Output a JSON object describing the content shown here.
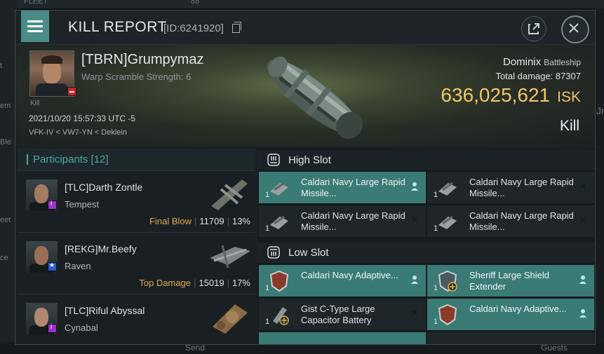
{
  "background": {
    "top_text": "FLEET",
    "top_count": "88",
    "left_fragments": [
      "t",
      "em",
      "Ble",
      "eet",
      "ce"
    ],
    "right_fragments": [
      "Jr"
    ],
    "bottom_send": "Send",
    "bottom_guests": "Guests"
  },
  "window": {
    "title": "KILL REPORT",
    "id_text": "[ID:6241920]",
    "icons": [
      "menu-icon",
      "copy-icon",
      "external-link-icon",
      "close-icon"
    ]
  },
  "victim": {
    "name": "[TBRN]Grumpymaz",
    "warp": "Warp Scramble Strength: 6",
    "kill_tag": "Kill",
    "time": "2021/10/20 15:57:33 UTC -5",
    "location": "VFK-IV < VW7-YN < Deklein"
  },
  "ship": {
    "name": "Dominix",
    "class": "Battleship",
    "total_damage_label": "Total damage:",
    "total_damage": "87307",
    "isk_value": "636,025,621",
    "isk_currency": "ISK",
    "result": "Kill"
  },
  "participants": {
    "label": "Participants",
    "count": "[12]",
    "list": [
      {
        "name": "[TLC]Darth Zontle",
        "ship": "Tempest",
        "tag": "Final Blow",
        "damage": "11709",
        "percent": "13%",
        "badge": "purple"
      },
      {
        "name": "[REKG]Mr.Beefy",
        "ship": "Raven",
        "tag": "Top Damage",
        "damage": "15019",
        "percent": "17%",
        "badge": "blue"
      },
      {
        "name": "[TLC]Riful Abyssal",
        "ship": "Cynabal",
        "tag": "",
        "damage": "",
        "percent": "",
        "badge": "purple"
      }
    ]
  },
  "slots": {
    "high": {
      "label": "High Slot",
      "modules": [
        {
          "name": "Caldari Navy Large Rapid Missile...",
          "qty": "1",
          "state": "dropped"
        },
        {
          "name": "Caldari Navy Large Rapid Missile...",
          "qty": "1",
          "state": "destroyed"
        },
        {
          "name": "Caldari Navy Large Rapid Missile...",
          "qty": "1",
          "state": "destroyed"
        },
        {
          "name": "Caldari Navy Large Rapid Missile...",
          "qty": "1",
          "state": "destroyed"
        }
      ]
    },
    "low": {
      "label": "Low Slot",
      "modules": [
        {
          "name": "Caldari Navy Adaptive...",
          "qty": "1",
          "state": "dropped"
        },
        {
          "name": "Sheriff Large Shield Extender",
          "qty": "1",
          "state": "dropped"
        },
        {
          "name": "Gist C-Type Large Capacitor Battery",
          "qty": "1",
          "state": "destroyed"
        },
        {
          "name": "Caldari Navy Adaptive...",
          "qty": "1",
          "state": "dropped"
        }
      ]
    }
  }
}
